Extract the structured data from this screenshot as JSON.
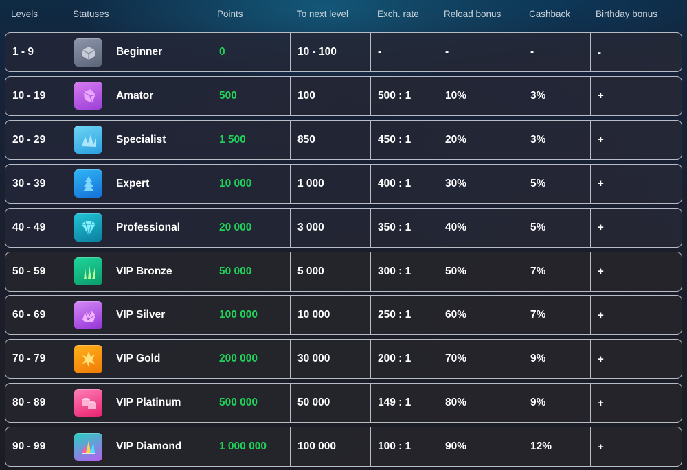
{
  "header": {
    "levels": "Levels",
    "statuses": "Statuses",
    "points": "Points",
    "to_next_level": "To next level",
    "exch_rate": "Exch. rate",
    "reload_bonus": "Reload bonus",
    "cashback": "Cashback",
    "birthday_bonus": "Birthday bonus"
  },
  "colors": {
    "points_green": "#1fd35a",
    "border": "#b9bcc4"
  },
  "rows": [
    {
      "levels": "1 - 9",
      "status": "Beginner",
      "icon": "stone-cube-icon",
      "badge_color": [
        "#8e96ab",
        "#5c6478"
      ],
      "points": "0",
      "to_next": "10 - 100",
      "rate": "-",
      "reload": "-",
      "cashback": "-",
      "birthday": "-"
    },
    {
      "levels": "10 - 19",
      "status": "Amator",
      "icon": "purple-gem-icon",
      "badge_color": [
        "#d77bf2",
        "#9a3fd6"
      ],
      "points": "500",
      "to_next": "100",
      "rate": "500 : 1",
      "reload": "10%",
      "cashback": "3%",
      "birthday": "+"
    },
    {
      "levels": "20 - 29",
      "status": "Specialist",
      "icon": "ice-crystal-icon",
      "badge_color": [
        "#6fd6f5",
        "#2a9ee0"
      ],
      "points": "1 500",
      "to_next": "850",
      "rate": "450 : 1",
      "reload": "20%",
      "cashback": "3%",
      "birthday": "+"
    },
    {
      "levels": "30 - 39",
      "status": "Expert",
      "icon": "blue-tree-icon",
      "badge_color": [
        "#2fb6f5",
        "#1570d8"
      ],
      "points": "10 000",
      "to_next": "1 000",
      "rate": "400 : 1",
      "reload": "30%",
      "cashback": "5%",
      "birthday": "+"
    },
    {
      "levels": "40 - 49",
      "status": "Professional",
      "icon": "diamond-icon",
      "badge_color": [
        "#22c4d6",
        "#0b7fa0"
      ],
      "points": "20 000",
      "to_next": "3 000",
      "rate": "350 : 1",
      "reload": "40%",
      "cashback": "5%",
      "birthday": "+"
    },
    {
      "levels": "50 - 59",
      "status": "VIP Bronze",
      "icon": "green-crystals-icon",
      "badge_color": [
        "#1fd69a",
        "#0b9a6a"
      ],
      "points": "50 000",
      "to_next": "5 000",
      "rate": "300 : 1",
      "reload": "50%",
      "cashback": "7%",
      "birthday": "+"
    },
    {
      "levels": "60 - 69",
      "status": "VIP Silver",
      "icon": "amethyst-icon",
      "badge_color": [
        "#d58af5",
        "#9333d8"
      ],
      "points": "100 000",
      "to_next": "10 000",
      "rate": "250 : 1",
      "reload": "60%",
      "cashback": "7%",
      "birthday": "+"
    },
    {
      "levels": "70 - 79",
      "status": "VIP Gold",
      "icon": "gold-crystal-icon",
      "badge_color": [
        "#ffb21a",
        "#f07a08"
      ],
      "points": "200 000",
      "to_next": "30 000",
      "rate": "200 : 1",
      "reload": "70%",
      "cashback": "9%",
      "birthday": "+"
    },
    {
      "levels": "80 - 89",
      "status": "VIP Platinum",
      "icon": "pink-coins-icon",
      "badge_color": [
        "#ff7fb6",
        "#e8216f"
      ],
      "points": "500 000",
      "to_next": "50 000",
      "rate": "149 : 1",
      "reload": "80%",
      "cashback": "9%",
      "birthday": "+"
    },
    {
      "levels": "90 - 99",
      "status": "VIP Diamond",
      "icon": "rainbow-crystals-icon",
      "badge_color": [
        "#24d1c0",
        "#b85ef0"
      ],
      "points": "1 000 000",
      "to_next": "100 000",
      "rate": "100 : 1",
      "reload": "90%",
      "cashback": "12%",
      "birthday": "+"
    }
  ]
}
